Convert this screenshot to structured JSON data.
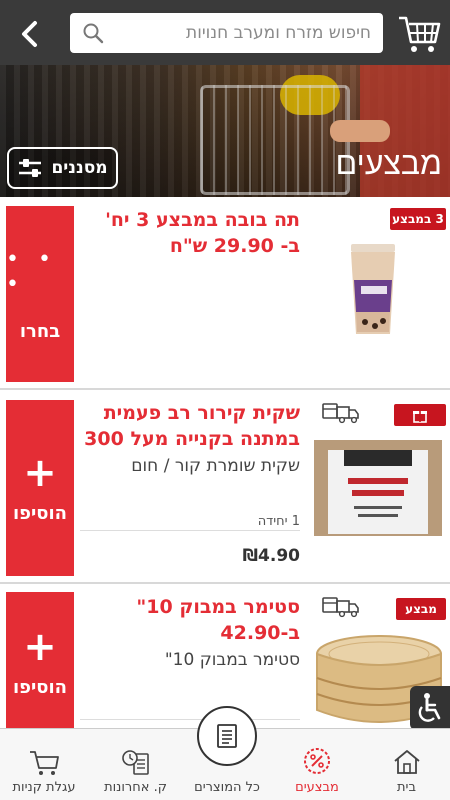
{
  "header": {
    "search_placeholder": "חיפוש מזרח ומערב חנויות"
  },
  "hero": {
    "title": "מבצעים",
    "filter_label": "מסננים"
  },
  "products": [
    {
      "badge": "3 במבצע",
      "title_line1": "תה בובה במבצע 3 יח'",
      "title_line2": "ב- 29.90 ש\"ח",
      "action_label": "בחרו",
      "action_glyph": "• • •"
    },
    {
      "title_line1": "שקית קירור רב פעמית",
      "title_line2": "במתנה בקנייה מעל 300",
      "subtitle": "שקית שומרת קור / חום",
      "unit": "1 יחידה",
      "price": "₪4.90",
      "action_label": "הוסיפו",
      "action_glyph": "+"
    },
    {
      "badge": "מבצע",
      "title_line1": "סטימר במבוק 10\"",
      "title_line2": "ב-42.90",
      "subtitle": "סטימר במבוק 10\"",
      "action_label": "הוסיפו",
      "action_glyph": "+"
    }
  ],
  "bottom_nav": [
    {
      "label": "עגלת קניות",
      "icon": "cart-icon"
    },
    {
      "label": "ק. אחרונות",
      "icon": "recent-purchases-icon"
    },
    {
      "label": "כל המוצרים",
      "icon": "list-icon"
    },
    {
      "label": "מבצעים",
      "icon": "percent-icon",
      "active": true
    },
    {
      "label": "בית",
      "icon": "home-icon"
    }
  ],
  "colors": {
    "brand_red": "#e42d35",
    "header_dark": "#3a3a3a"
  }
}
